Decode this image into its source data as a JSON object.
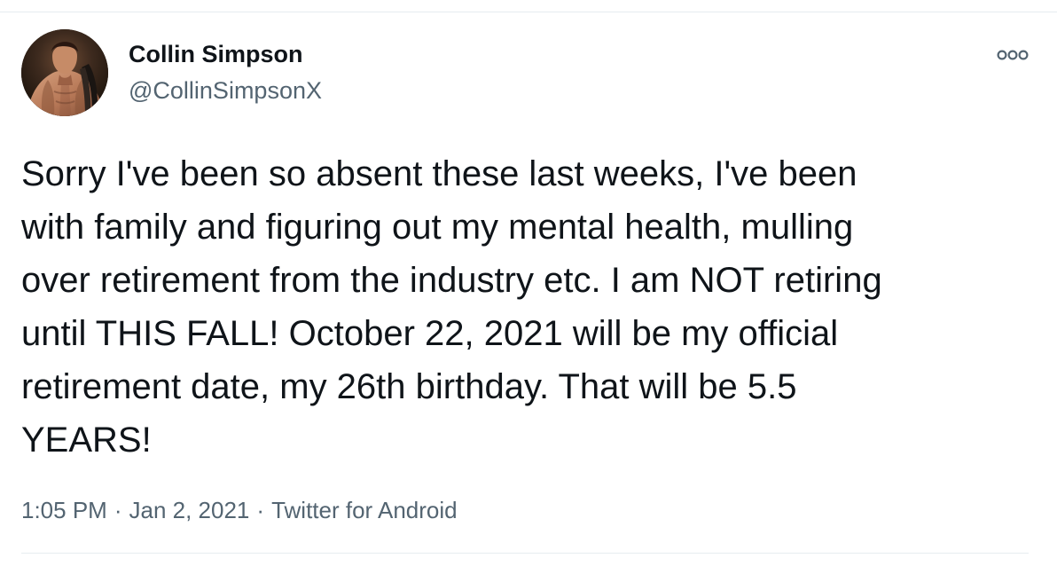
{
  "tweet": {
    "author": {
      "name": "Collin Simpson",
      "handle": "@CollinSimpsonX"
    },
    "text": "Sorry I've been so absent these last weeks, I've been\nwith family and figuring out my mental health, mulling\nover retirement from the industry etc. I am NOT retiring\nuntil THIS FALL! October 22, 2021 will be my official\nretirement date, my 26th birthday. That will be 5.5\nYEARS!",
    "time": "1:05 PM",
    "date": "Jan 2, 2021",
    "source": "Twitter for Android",
    "separator": "·"
  },
  "icons": {
    "more": "more-options-icon",
    "avatar": "profile-avatar"
  },
  "colors": {
    "text": "#0f1419",
    "secondary": "#536471",
    "border": "#e6ecf0",
    "background": "#ffffff"
  }
}
